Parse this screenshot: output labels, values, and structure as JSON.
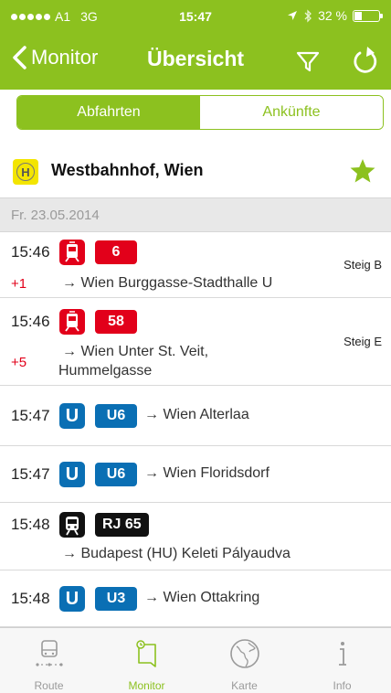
{
  "status_bar": {
    "carrier": "A1",
    "network": "3G",
    "time": "15:47",
    "battery": "32 %",
    "battery_level": 0.32
  },
  "nav": {
    "back_label": "Monitor",
    "title": "Übersicht",
    "filter_icon": "filter-icon",
    "refresh_icon": "refresh-icon"
  },
  "tabs": {
    "departures": "Abfahrten",
    "arrivals": "Ankünfte",
    "active": "departures"
  },
  "station": {
    "name": "Westbahnhof, Wien",
    "favorite": true
  },
  "date": "Fr. 23.05.2014",
  "departures": [
    {
      "time": "15:46",
      "delay": "+1",
      "mode": "tram",
      "line": "6",
      "destination": "→ Wien Burggasse-Stadthalle U",
      "platform": "Steig B"
    },
    {
      "time": "15:46",
      "delay": "+5",
      "mode": "tram",
      "line": "58",
      "destination_line1": "→ Wien Unter St. Veit,",
      "destination_line2": "Hummelgasse",
      "platform": "Steig E"
    },
    {
      "time": "15:47",
      "mode": "ubahn",
      "icon_letter": "U",
      "line": "U6",
      "destination": "→ Wien Alterlaa"
    },
    {
      "time": "15:47",
      "mode": "ubahn",
      "icon_letter": "U",
      "line": "U6",
      "destination": "→ Wien Floridsdorf"
    },
    {
      "time": "15:48",
      "mode": "rail",
      "line": "RJ 65",
      "destination": "→ Budapest (HU) Keleti Pályaudva"
    },
    {
      "time": "15:48",
      "mode": "ubahn",
      "icon_letter": "U",
      "line": "U3",
      "destination": "→ Wien Ottakring"
    }
  ],
  "tabbar": [
    {
      "label": "Route",
      "icon": "bus-icon"
    },
    {
      "label": "Monitor",
      "icon": "monitor-icon",
      "active": true
    },
    {
      "label": "Karte",
      "icon": "globe-icon"
    },
    {
      "label": "Info",
      "icon": "info-icon"
    }
  ],
  "colors": {
    "brand_green": "#8cc11f",
    "tram_red": "#e2001a",
    "ubahn_blue": "#0a6fb4",
    "rail_black": "#111111",
    "delay_red": "#e2001a"
  }
}
